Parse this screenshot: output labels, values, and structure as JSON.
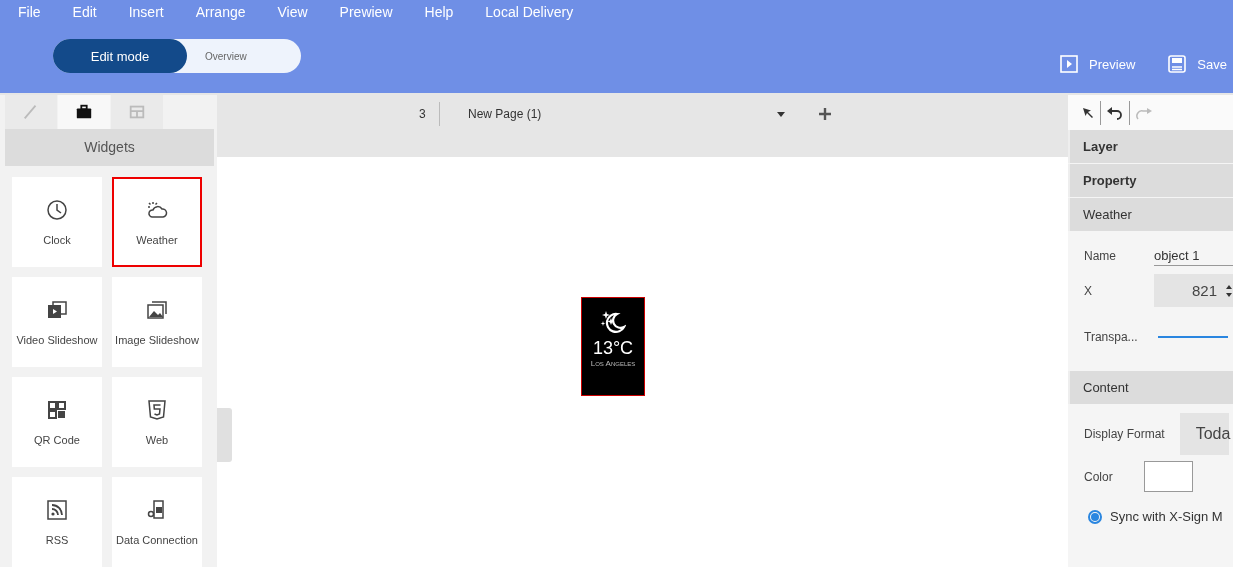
{
  "menu": [
    "File",
    "Edit",
    "Insert",
    "Arrange",
    "View",
    "Prewiew",
    "Help",
    "Local Delivery"
  ],
  "modes": [
    {
      "label": "Edit mode",
      "selected": true
    },
    {
      "label": "Overview",
      "selected": false
    }
  ],
  "actions": [
    {
      "kind": "preview",
      "label": "Preview"
    },
    {
      "kind": "save",
      "label": "Save"
    }
  ],
  "sidebar": {
    "tabs": [
      {
        "kind": "pencil",
        "selected": false
      },
      {
        "kind": "briefcase",
        "selected": true
      },
      {
        "kind": "layout",
        "selected": false
      }
    ],
    "header": "Widgets",
    "widgets": [
      {
        "kind": "clock",
        "label": "Clock",
        "highlighted": false
      },
      {
        "kind": "weather",
        "label": "Weather",
        "highlighted": true
      },
      {
        "kind": "video",
        "label": "Video Slideshow",
        "highlighted": false
      },
      {
        "kind": "image",
        "label": "Image Slideshow",
        "highlighted": false
      },
      {
        "kind": "qr",
        "label": "QR Code",
        "highlighted": false
      },
      {
        "kind": "html5",
        "label": "Web",
        "highlighted": false
      },
      {
        "kind": "rss",
        "label": "RSS",
        "highlighted": false
      },
      {
        "kind": "data",
        "label": "Data Connection",
        "highlighted": false
      }
    ]
  },
  "page_bar": {
    "count": "3",
    "page": "New Page (1)"
  },
  "canvas": {
    "weather_widget": {
      "temperature": "13°C",
      "city": "Los Angeles"
    }
  },
  "panel": {
    "sections": [
      {
        "label": "Layer",
        "bold": true
      },
      {
        "label": "Property",
        "bold": true
      },
      {
        "label": "Weather",
        "bold": false
      }
    ],
    "name_label": "Name",
    "name_value": "object 1",
    "x_label": "X",
    "x_value": "821",
    "transparency_label": "Transpa...",
    "transparency": {
      "level": 1
    },
    "content_header": "Content",
    "format_label": "Display Format",
    "format_value": "Toda",
    "color_label": "Color",
    "sync": {
      "label": "Sync with X-Sign M",
      "selected": true
    }
  }
}
